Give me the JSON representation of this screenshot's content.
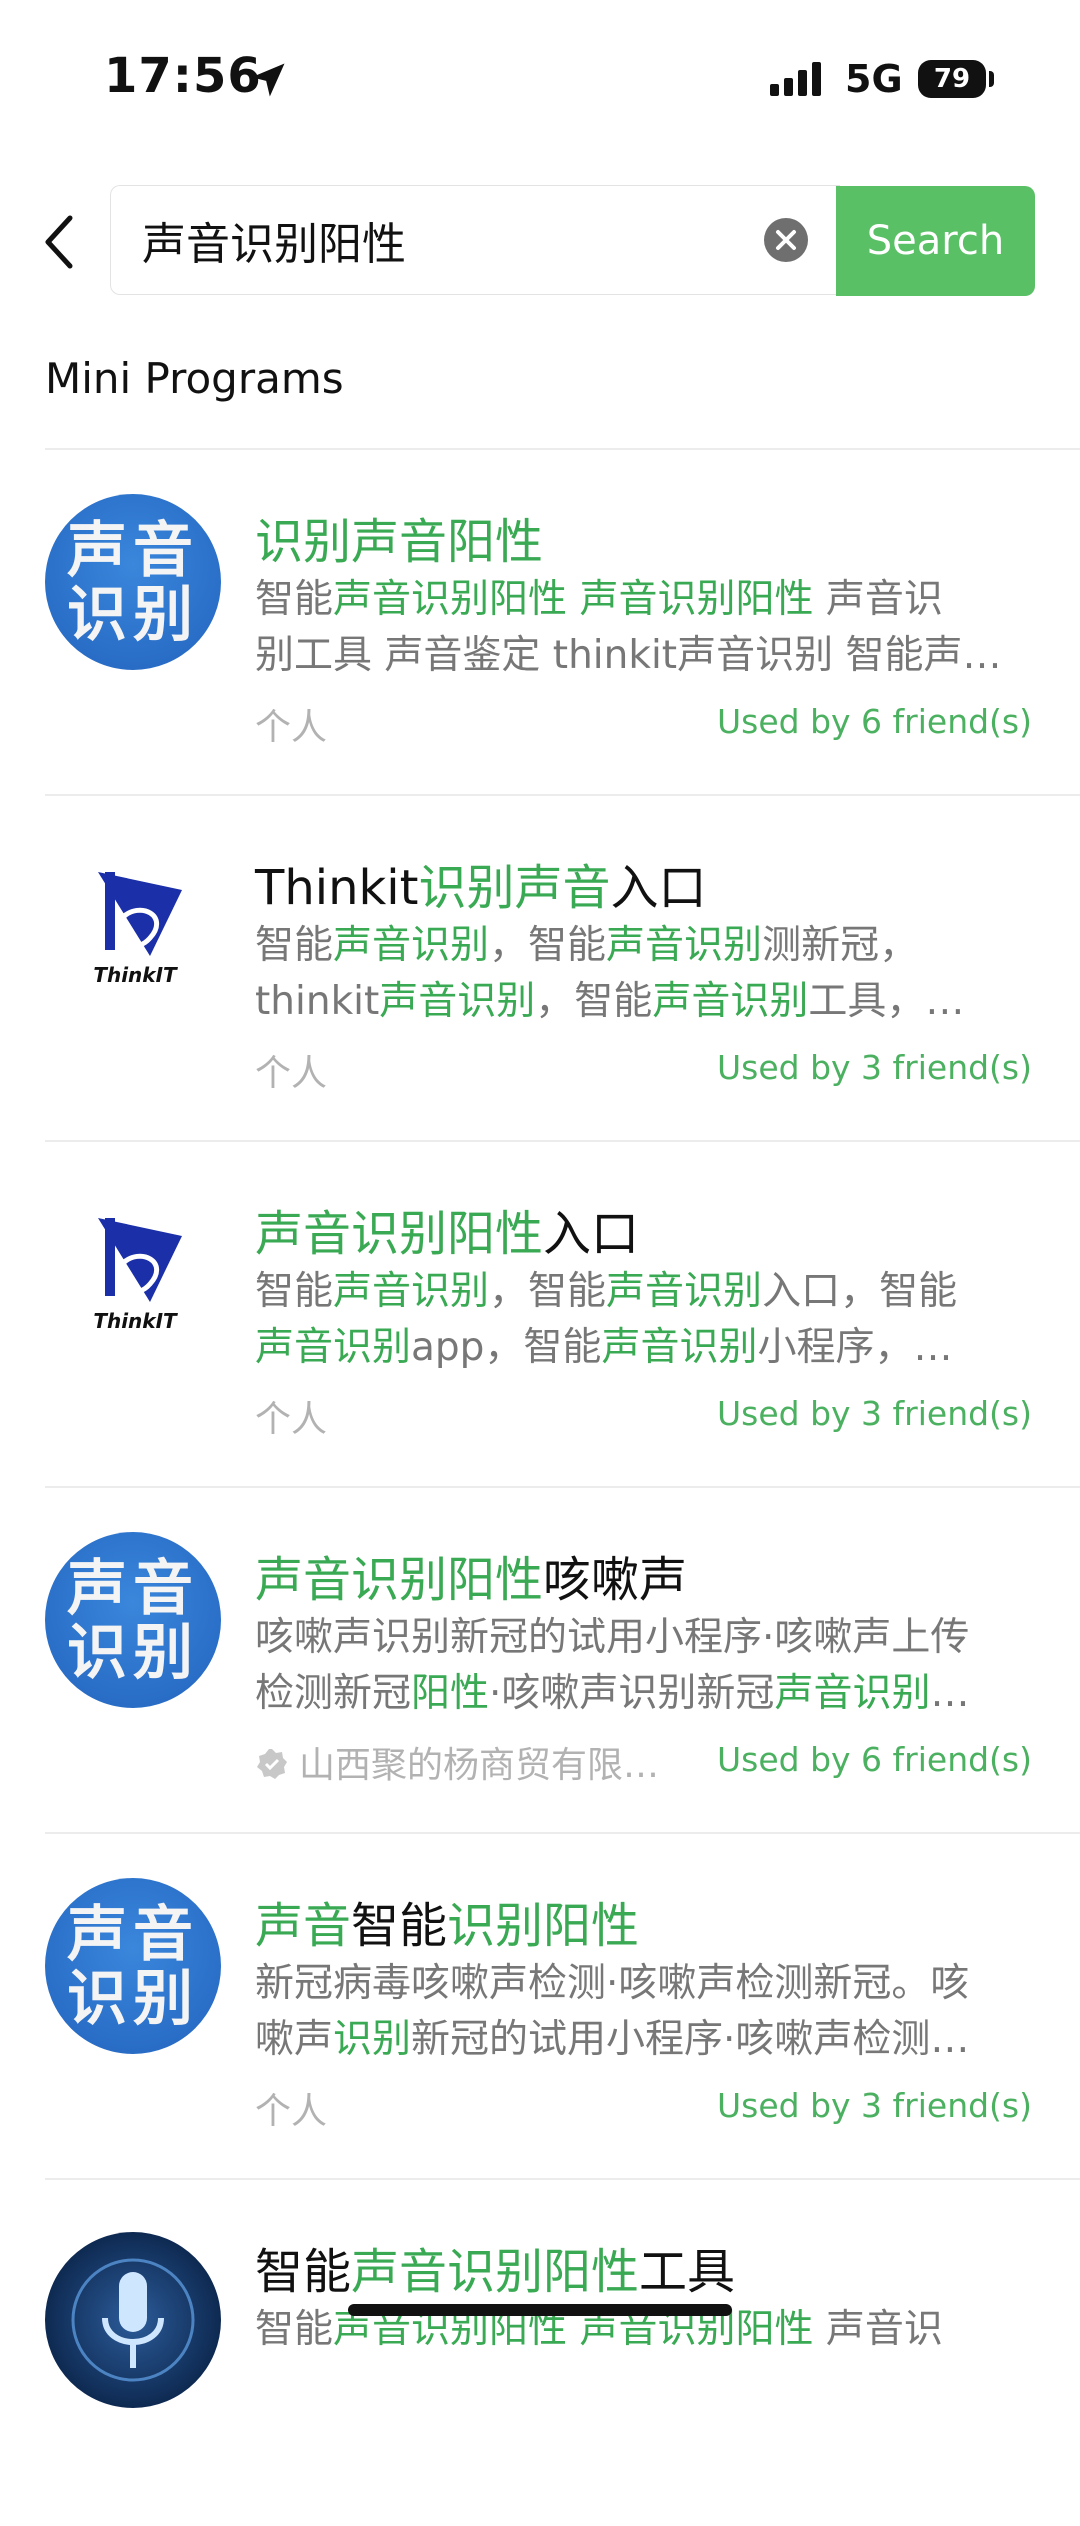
{
  "status_bar": {
    "time": "17:56",
    "network": "5G",
    "battery": "79"
  },
  "search": {
    "query": "声音识别阳性",
    "button_label": "Search"
  },
  "section_title": "Mini Programs",
  "results": [
    {
      "logo": "voice-recognition-logo",
      "title": [
        {
          "t": "识别声音阳性",
          "h": true
        }
      ],
      "desc1": [
        {
          "t": "智能",
          "h": false
        },
        {
          "t": "声音识别阳性",
          "h": true
        },
        {
          "t": " ",
          "h": false
        },
        {
          "t": "声音识别阳性",
          "h": true
        },
        {
          "t": " 声音识",
          "h": false
        }
      ],
      "desc2": [
        {
          "t": "别工具 声音鉴定 thinkit声音识别 智能声…",
          "h": false
        }
      ],
      "owner": "个人",
      "owner_verified": false,
      "friends": "Used by 6 friend(s)"
    },
    {
      "logo": "thinkit-logo",
      "title": [
        {
          "t": "Thinkit",
          "h": false
        },
        {
          "t": "识别声音",
          "h": true
        },
        {
          "t": "入口",
          "h": false
        }
      ],
      "desc1": [
        {
          "t": "智能",
          "h": false
        },
        {
          "t": "声音识别",
          "h": true
        },
        {
          "t": "，智能",
          "h": false
        },
        {
          "t": "声音识别",
          "h": true
        },
        {
          "t": "测新冠，",
          "h": false
        }
      ],
      "desc2": [
        {
          "t": "thinkit",
          "h": false
        },
        {
          "t": "声音识别",
          "h": true
        },
        {
          "t": "，智能",
          "h": false
        },
        {
          "t": "声音识别",
          "h": true
        },
        {
          "t": "工具，…",
          "h": false
        }
      ],
      "owner": "个人",
      "owner_verified": false,
      "friends": "Used by 3 friend(s)"
    },
    {
      "logo": "thinkit-logo",
      "title": [
        {
          "t": "声音识别阳性",
          "h": true
        },
        {
          "t": "入口",
          "h": false
        }
      ],
      "desc1": [
        {
          "t": "智能",
          "h": false
        },
        {
          "t": "声音识别",
          "h": true
        },
        {
          "t": "，智能",
          "h": false
        },
        {
          "t": "声音识别",
          "h": true
        },
        {
          "t": "入口，智能",
          "h": false
        }
      ],
      "desc2": [
        {
          "t": "声音识别",
          "h": true
        },
        {
          "t": "app，智能",
          "h": false
        },
        {
          "t": "声音识别",
          "h": true
        },
        {
          "t": "小程序，…",
          "h": false
        }
      ],
      "owner": "个人",
      "owner_verified": false,
      "friends": "Used by 3 friend(s)"
    },
    {
      "logo": "voice-recognition-logo",
      "title": [
        {
          "t": "声音识别阳性",
          "h": true
        },
        {
          "t": "咳嗽声",
          "h": false
        }
      ],
      "desc1": [
        {
          "t": "咳嗽声识别新冠的试用小程序·咳嗽声上传",
          "h": false
        }
      ],
      "desc2": [
        {
          "t": "检测新冠",
          "h": false
        },
        {
          "t": "阳性",
          "h": true
        },
        {
          "t": "·咳嗽声识别新冠",
          "h": false
        },
        {
          "t": "声音识别",
          "h": true
        },
        {
          "t": "…",
          "h": false
        }
      ],
      "owner": "山西聚的杨商贸有限…",
      "owner_verified": true,
      "friends": "Used by 6 friend(s)"
    },
    {
      "logo": "voice-recognition-logo",
      "title": [
        {
          "t": "声音",
          "h": true
        },
        {
          "t": "智能",
          "h": false
        },
        {
          "t": "识别阳性",
          "h": true
        }
      ],
      "desc1": [
        {
          "t": "新冠病毒咳嗽声检测·咳嗽声检测新冠。咳",
          "h": false
        }
      ],
      "desc2": [
        {
          "t": "嗽声",
          "h": false
        },
        {
          "t": "识别",
          "h": true
        },
        {
          "t": "新冠的试用小程序·咳嗽声检测…",
          "h": false
        }
      ],
      "owner": "个人",
      "owner_verified": false,
      "friends": "Used by 3 friend(s)"
    },
    {
      "logo": "microphone-logo",
      "title": [
        {
          "t": "智能",
          "h": false
        },
        {
          "t": "声音识别阳性",
          "h": true
        },
        {
          "t": "工具",
          "h": false
        }
      ],
      "desc1": [
        {
          "t": "智能",
          "h": false
        },
        {
          "t": "声音识别阳性",
          "h": true
        },
        {
          "t": " ",
          "h": false
        },
        {
          "t": "声音识别阳性",
          "h": true
        },
        {
          "t": " 声音识",
          "h": false
        }
      ],
      "desc2": [],
      "owner": "",
      "owner_verified": false,
      "friends": ""
    }
  ],
  "logo_text": {
    "line1": "声音",
    "line2": "识别",
    "thinkit": "ThinkIT"
  },
  "colors": {
    "accent": "#5ac066",
    "highlight": "#3aa953",
    "muted": "#777777"
  }
}
